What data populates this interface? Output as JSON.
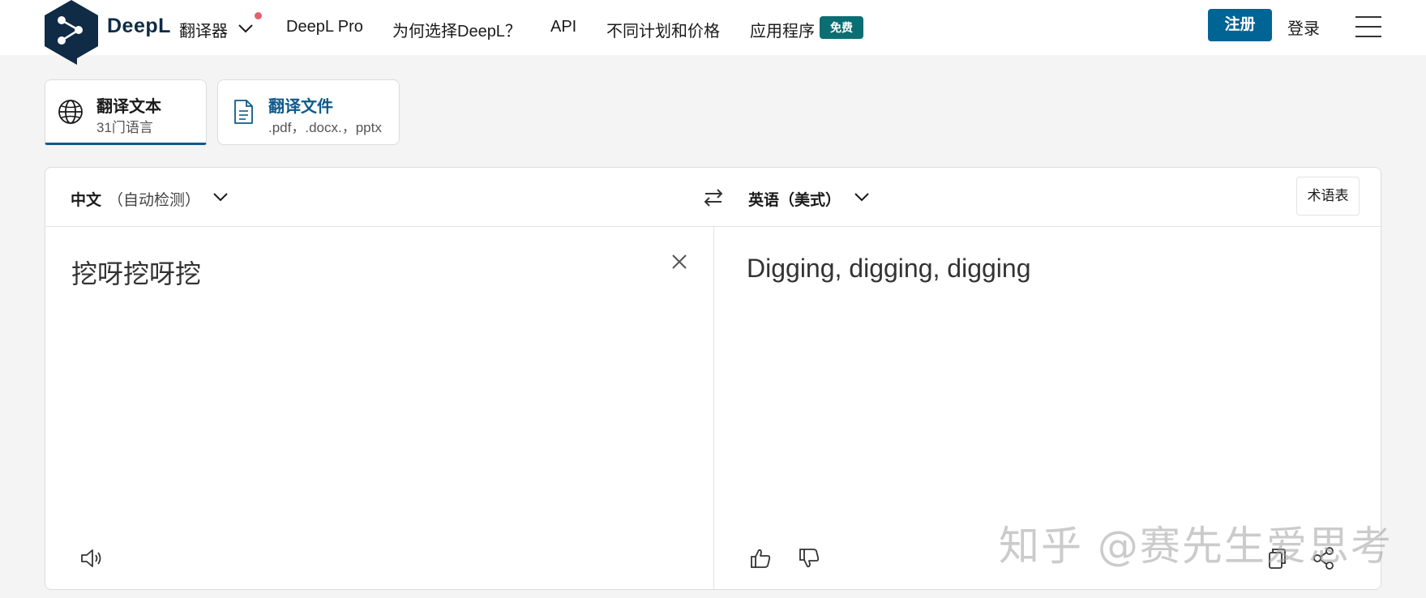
{
  "header": {
    "brand": "DeepL",
    "product": "翻译器",
    "nav": [
      {
        "label": "DeepL Pro"
      },
      {
        "label": "为何选择DeepL？"
      },
      {
        "label": "API"
      },
      {
        "label": "不同计划和价格"
      },
      {
        "label": "应用程序"
      }
    ],
    "free_badge": "免费",
    "signup_label": "注册",
    "login_label": "登录"
  },
  "modes": {
    "text": {
      "title": "翻译文本",
      "subtitle": "31门语言"
    },
    "files": {
      "title": "翻译文件",
      "subtitle": ".pdf，.docx.，pptx"
    }
  },
  "translator": {
    "source_lang": "中文",
    "source_detect": "（自动检测）",
    "target_lang": "英语（美式）",
    "glossary_label": "术语表",
    "source_text": "挖呀挖呀挖",
    "target_text": "Digging, digging, digging"
  },
  "watermark": "知乎 @赛先生爱思考",
  "colors": {
    "brand_navy": "#0f2b46",
    "primary_blue": "#006494",
    "badge_teal": "#0b6e73",
    "notification_red": "#e1626e"
  },
  "icons": {
    "logo": "deepl-logo-icon",
    "mode_text": "globe-icon",
    "mode_files": "document-icon",
    "swap": "swap-arrows-icon",
    "clear": "close-icon",
    "speaker": "speaker-icon",
    "like": "thumbs-up-icon",
    "dislike": "thumbs-down-icon",
    "copy": "copy-icon",
    "share": "share-icon",
    "menu": "hamburger-menu-icon"
  }
}
